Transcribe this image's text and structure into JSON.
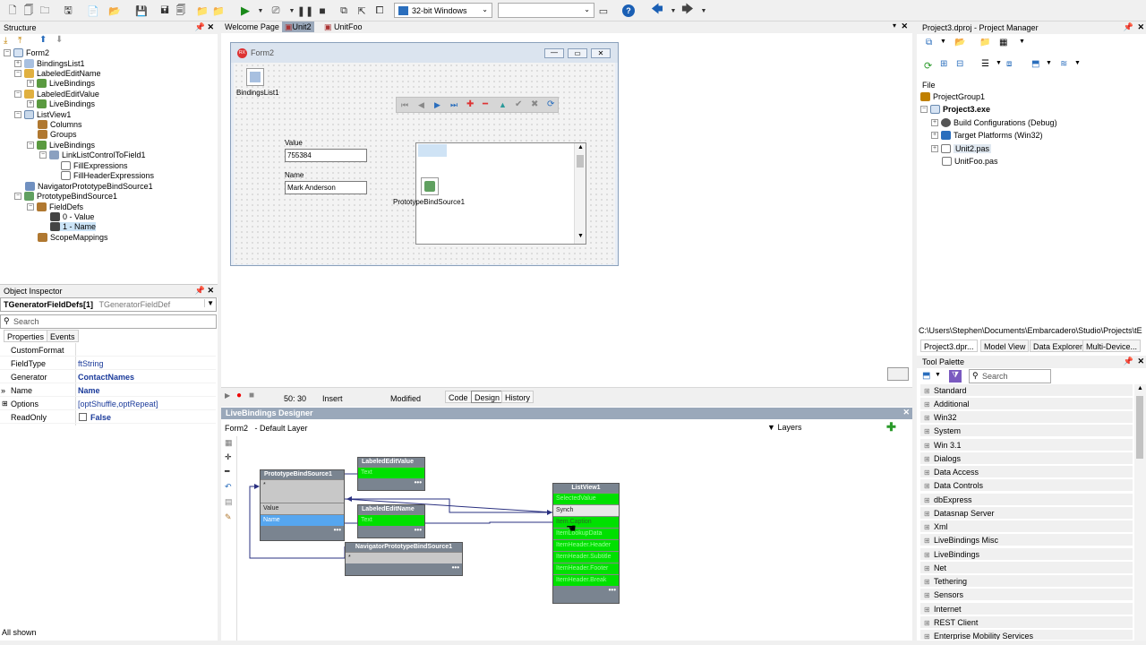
{
  "toolbar": {
    "platform": "32-bit Windows",
    "config": "",
    "help": "?"
  },
  "structure": {
    "title": "Structure",
    "items": [
      "Form2",
      "BindingsList1",
      "LabeledEditName",
      "LiveBindings",
      "LabeledEditValue",
      "LiveBindings",
      "ListView1",
      "Columns",
      "Groups",
      "LiveBindings",
      "LinkListControlToField1",
      "FillExpressions",
      "FillHeaderExpressions",
      "NavigatorPrototypeBindSource1",
      "PrototypeBindSource1",
      "FieldDefs",
      "0 - Value",
      "1 - Name",
      "ScopeMappings"
    ]
  },
  "object_inspector": {
    "title": "Object Inspector",
    "selected": "TGeneratorFieldDefs[1]",
    "selected_type": "TGeneratorFieldDef",
    "search_placeholder": "Search",
    "tab_properties": "Properties",
    "tab_events": "Events",
    "rows": [
      {
        "name": "CustomFormat",
        "value": ""
      },
      {
        "name": "FieldType",
        "value": "ftString"
      },
      {
        "name": "Generator",
        "value": "ContactNames"
      },
      {
        "name": "Name",
        "value": "Name"
      },
      {
        "name": "Options",
        "value": "[optShuffle,optRepeat]"
      },
      {
        "name": "ReadOnly",
        "value": "False"
      }
    ],
    "status": "All shown"
  },
  "editor_tabs": [
    "Welcome Page",
    "Unit2",
    "UnitFoo"
  ],
  "form": {
    "title": "Form2",
    "bindings_label": "BindingsList1",
    "value_label": "Value",
    "value": "755384",
    "name_label": "Name",
    "name_value": "Mark Anderson",
    "bindsource_label": "PrototypeBindSource1"
  },
  "statusbar": {
    "position": "50: 30",
    "mode": "Insert",
    "modified": "Modified",
    "tabs": [
      "Code",
      "Design",
      "History"
    ]
  },
  "livebindings": {
    "title": "LiveBindings Designer",
    "layer": "Form2   - Default Layer",
    "layers_label": "Layers",
    "pbs": {
      "title": "PrototypeBindSource1",
      "rows": [
        "*",
        "Value",
        "Name"
      ]
    },
    "lev": {
      "title": "LabeledEditValue",
      "rows": [
        "Text"
      ]
    },
    "len": {
      "title": "LabeledEditName",
      "rows": [
        "Text"
      ]
    },
    "nav": {
      "title": "NavigatorPrototypeBindSource1",
      "rows": [
        "*"
      ]
    },
    "lv": {
      "title": "ListView1",
      "rows": [
        "SelectedValue",
        "Synch",
        "Item.Caption",
        "ItemLookupData",
        "ItemHeader.Header",
        "ItemHeader.Subtitle",
        "ItemHeader.Footer",
        "ItemHeader.Break"
      ]
    }
  },
  "project_manager": {
    "title": "Project3.dproj - Project Manager",
    "file_label": "File",
    "items": [
      "ProjectGroup1",
      "Project3.exe",
      "Build Configurations (Debug)",
      "Target Platforms (Win32)",
      "Unit2.pas",
      "UnitFoo.pas"
    ],
    "path": "C:\\Users\\Stephen\\Documents\\Embarcadero\\Studio\\Projects\\tE",
    "tabs": [
      "Project3.dpr...",
      "Model View",
      "Data Explorer",
      "Multi-Device..."
    ]
  },
  "tool_palette": {
    "title": "Tool Palette",
    "search_placeholder": "Search",
    "items": [
      "Standard",
      "Additional",
      "Win32",
      "System",
      "Win 3.1",
      "Dialogs",
      "Data Access",
      "Data Controls",
      "dbExpress",
      "Datasnap Server",
      "Xml",
      "LiveBindings Misc",
      "LiveBindings",
      "Net",
      "Tethering",
      "Sensors",
      "Internet",
      "REST Client",
      "Enterprise Mobility Services"
    ]
  }
}
